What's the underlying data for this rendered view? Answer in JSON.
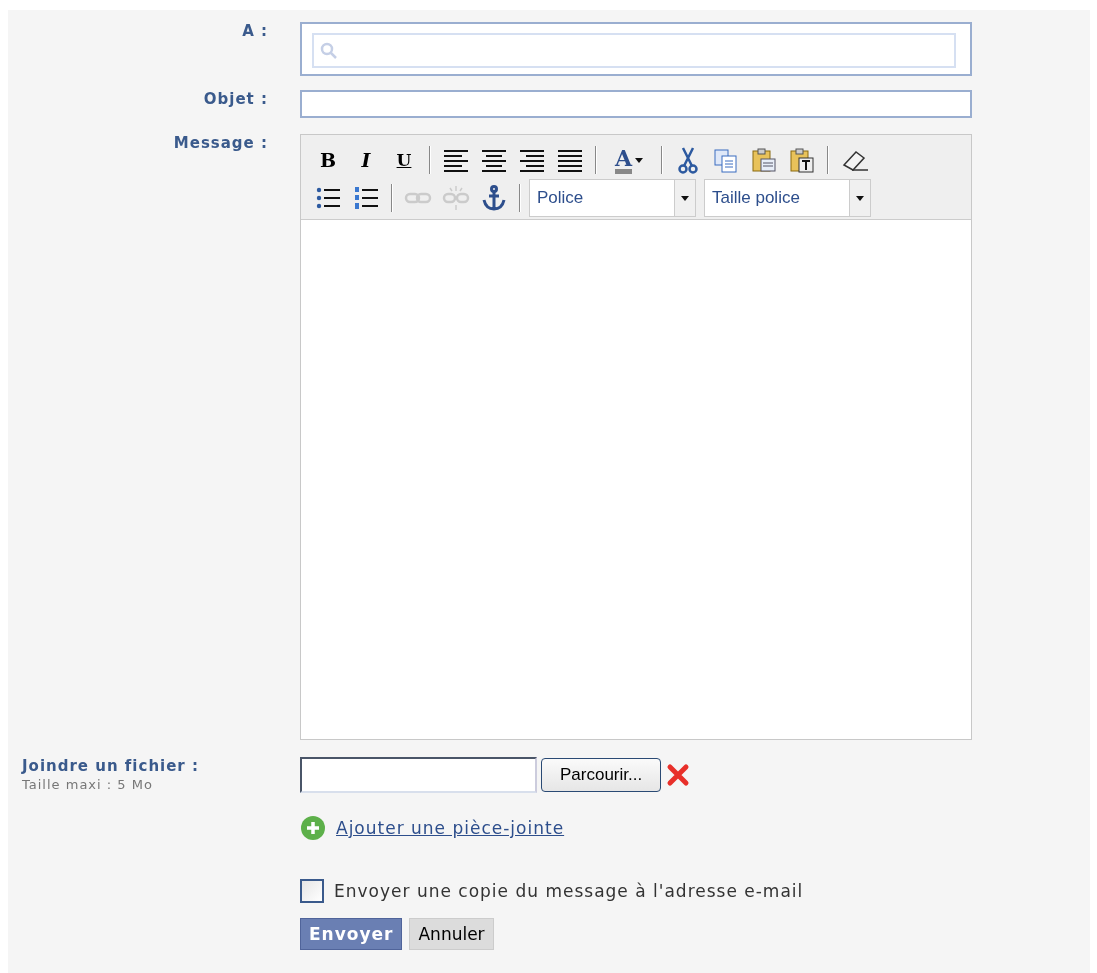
{
  "recipient": {
    "label": "A :"
  },
  "subject": {
    "label": "Objet :"
  },
  "message": {
    "label": "Message :",
    "toolbar": [
      [
        {
          "kind": "bold",
          "label": "B",
          "disabled": false
        },
        {
          "kind": "italic",
          "label": "I",
          "disabled": false
        },
        {
          "kind": "underline",
          "label": "U",
          "disabled": false
        },
        {
          "kind": "separator"
        },
        {
          "kind": "align-left",
          "disabled": false
        },
        {
          "kind": "align-center",
          "disabled": false
        },
        {
          "kind": "align-right",
          "disabled": false
        },
        {
          "kind": "justify",
          "disabled": false
        },
        {
          "kind": "separator"
        },
        {
          "kind": "text-color",
          "label": "A",
          "disabled": false
        },
        {
          "kind": "separator"
        },
        {
          "kind": "cut",
          "disabled": false
        },
        {
          "kind": "copy",
          "disabled": false
        },
        {
          "kind": "paste",
          "disabled": false
        },
        {
          "kind": "paste-text",
          "disabled": false
        },
        {
          "kind": "separator"
        },
        {
          "kind": "eraser",
          "disabled": false
        }
      ],
      [
        {
          "kind": "bullet-list",
          "disabled": false
        },
        {
          "kind": "numbered-list",
          "disabled": false
        },
        {
          "kind": "separator"
        },
        {
          "kind": "link",
          "disabled": true
        },
        {
          "kind": "unlink",
          "disabled": true
        },
        {
          "kind": "anchor",
          "disabled": false
        },
        {
          "kind": "separator"
        },
        {
          "kind": "select",
          "label": "Police"
        },
        {
          "kind": "select",
          "label": "Taille police"
        }
      ]
    ]
  },
  "attachment": {
    "label": "Joindre un fichier :",
    "hint": "Taille maxi : 5 Mo",
    "browse_button": "Parcourir...",
    "add_link": "Ajouter une pièce-jointe"
  },
  "copy_checkbox": {
    "label": "Envoyer une copie du message à l'adresse e-mail",
    "checked": false
  },
  "buttons": [
    {
      "label": "Envoyer",
      "kind": "primary"
    },
    {
      "label": "Annuler",
      "kind": "secondary"
    }
  ]
}
